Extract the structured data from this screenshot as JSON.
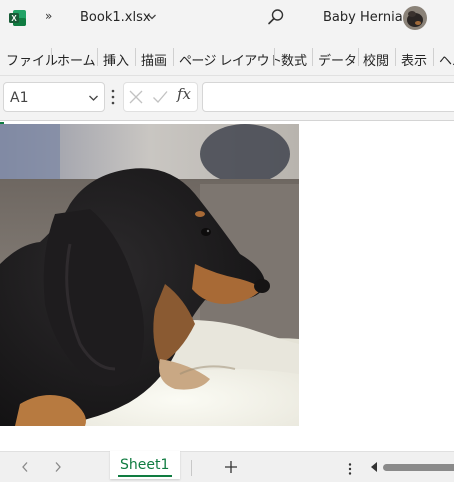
{
  "titlebar": {
    "app_icon": "excel-logo-icon",
    "app_icon_letter": "X",
    "quick_access_more": "»",
    "file_name": "Book1.xlsx",
    "search_icon": "search-icon",
    "user_name": "Baby Hernia",
    "avatar": "user-avatar"
  },
  "ribbon": {
    "tabs": [
      "ファイル",
      "ホーム",
      "挿入",
      "描画",
      "ページ レイアウト",
      "数式",
      "データ",
      "校閲",
      "表示",
      "ヘル"
    ]
  },
  "formula_bar": {
    "name_box_value": "A1",
    "fx_label": "fx",
    "formula_value": ""
  },
  "sheet": {
    "picture": "dachshund-photo",
    "picture_subject": "long-haired dachshund lying on a blanket"
  },
  "sheet_tabs": {
    "active_sheet": "Sheet1",
    "add_sheet_symbol": "+"
  },
  "colors": {
    "excel_green": "#107c41",
    "chrome_bg": "#f3f3f3"
  }
}
